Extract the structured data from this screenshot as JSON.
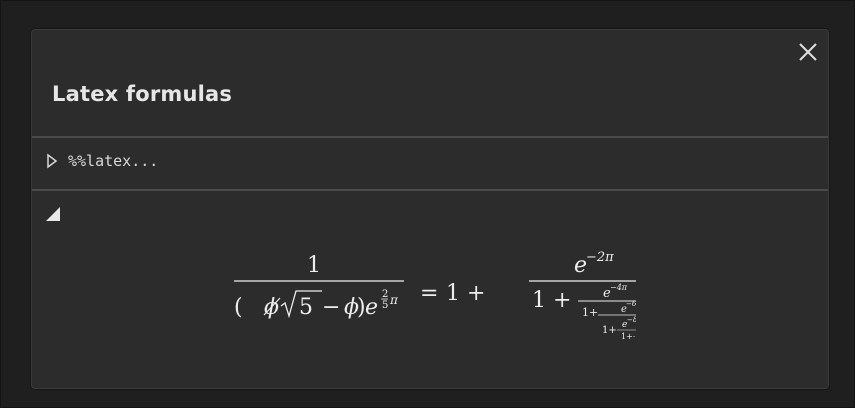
{
  "dialog": {
    "title": "Latex formulas",
    "close_icon": "close-icon"
  },
  "cell": {
    "input_toggle_icon": "expand-triangle-icon",
    "input_code": "%%latex...",
    "output_toggle_icon": "collapse-triangle-icon"
  },
  "formula": {
    "lhs_numerator": "1",
    "lhs_denominator": {
      "open_paren": "(",
      "phi_strike": "ϕ",
      "radicand": "5",
      "minus": "−",
      "phi": "ϕ",
      "close_paren": ")",
      "e": "e",
      "exponent_frac_num": "2",
      "exponent_frac_den": "5",
      "exponent_pi": "π"
    },
    "equals": "=",
    "one": "1",
    "plus": "+",
    "rhs_numerator": "e",
    "rhs_numerator_exp": "−2π",
    "cf_level1": {
      "one": "1",
      "plus": "+",
      "num": "e",
      "num_exp": "−4π"
    },
    "cf_level2": {
      "one": "1+",
      "num": "e",
      "num_exp": "−6π"
    },
    "cf_level3": {
      "one": "1+",
      "num": "e",
      "num_exp": "−8π",
      "den": "1+⋯"
    }
  }
}
